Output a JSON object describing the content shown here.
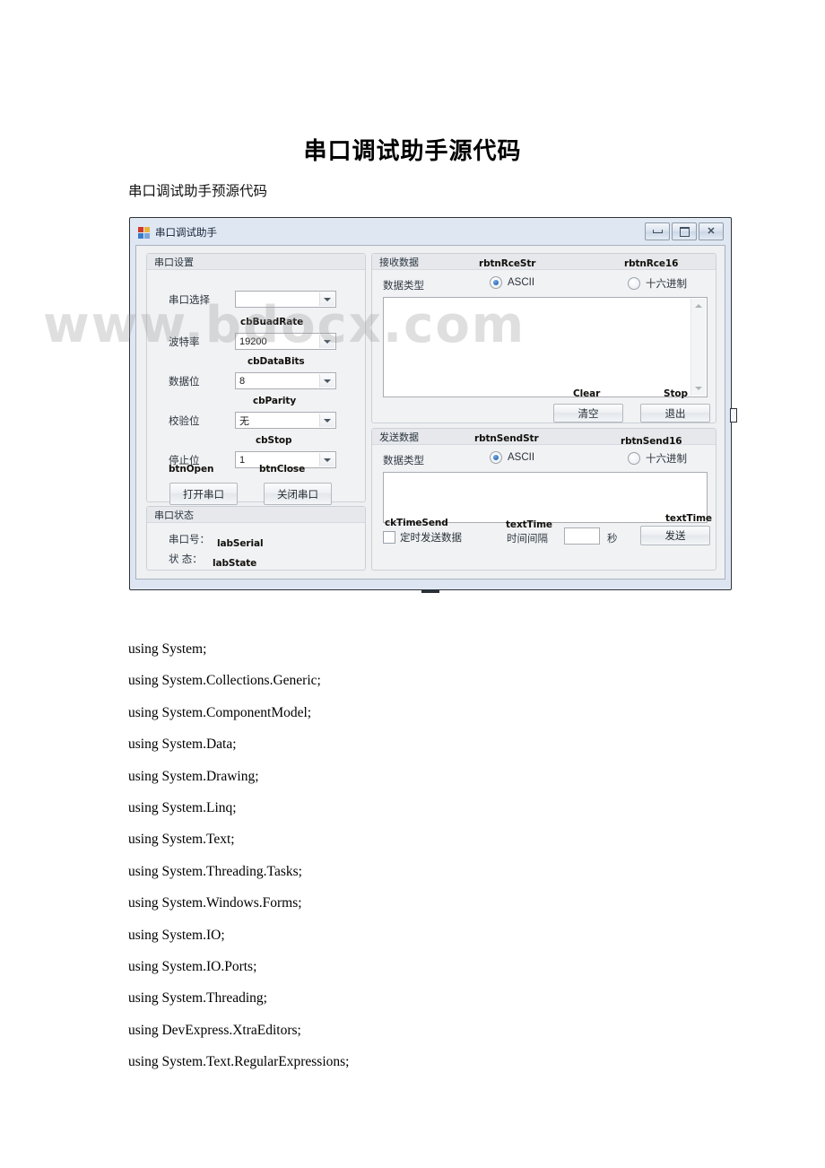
{
  "document": {
    "title": "串口调试助手源代码",
    "subtitle": "串口调试助手预源代码",
    "code_lines": [
      "using System;",
      "using System.Collections.Generic;",
      "using System.ComponentModel;",
      "using System.Data;",
      "using System.Drawing;",
      "using System.Linq;",
      "using System.Text;",
      "using System.Threading.Tasks;",
      "using System.Windows.Forms;",
      "using System.IO;",
      "using System.IO.Ports;",
      "using System.Threading;",
      "using DevExpress.XtraEditors;",
      "using System.Text.RegularExpressions;"
    ]
  },
  "watermark": "www.bdocx.com",
  "app": {
    "title": "串口调试助手",
    "window_buttons": {
      "minimize": "minimize-icon",
      "maximize": "maximize-icon",
      "close": "✕"
    },
    "serial_settings": {
      "group_title": "串口设置",
      "rows": [
        {
          "label": "串口选择",
          "value": "",
          "annotation": ""
        },
        {
          "label": "波特率",
          "value": "19200",
          "annotation": "cbBuadRate"
        },
        {
          "label": "数据位",
          "value": "8",
          "annotation": "cbDataBits"
        },
        {
          "label": "校验位",
          "value": "无",
          "annotation": "cbParity"
        },
        {
          "label": "停止位",
          "value": "1",
          "annotation": "cbStop"
        }
      ],
      "open_button": {
        "label": "打开串口",
        "annotation": "btnOpen"
      },
      "close_button": {
        "label": "关闭串口",
        "annotation": "btnClose"
      }
    },
    "serial_status": {
      "group_title": "串口状态",
      "port_label": "串口号：",
      "port_value": "labSerial",
      "state_label": "状 态：",
      "state_value": "labState"
    },
    "receive": {
      "group_title": "接收数据",
      "datatype_label": "数据类型",
      "radio_ascii": {
        "label": "ASCII",
        "checked": true,
        "annotation": "rbtnRceStr"
      },
      "radio_hex": {
        "label": "十六进制",
        "checked": false,
        "annotation": "rbtnRce16"
      },
      "textarea_value": "",
      "clear_button": {
        "label": "清空",
        "annotation": "Clear"
      },
      "exit_button": {
        "label": "退出",
        "annotation": "Stop"
      }
    },
    "send": {
      "group_title": "发送数据",
      "datatype_label": "数据类型",
      "radio_ascii": {
        "label": "ASCII",
        "checked": true,
        "annotation": "rbtnSendStr"
      },
      "radio_hex": {
        "label": "十六进制",
        "checked": false,
        "annotation": "rbtnSend16"
      },
      "textarea_value": "",
      "timed_checkbox": {
        "label": "定时发送数据",
        "checked": false,
        "annotation": "ckTimeSend"
      },
      "interval_label": "时间间隔",
      "interval_value": "",
      "interval_annotation": "textTime",
      "seconds_label": "秒",
      "send_button": {
        "label": "发送",
        "annotation": "textTime"
      }
    }
  }
}
